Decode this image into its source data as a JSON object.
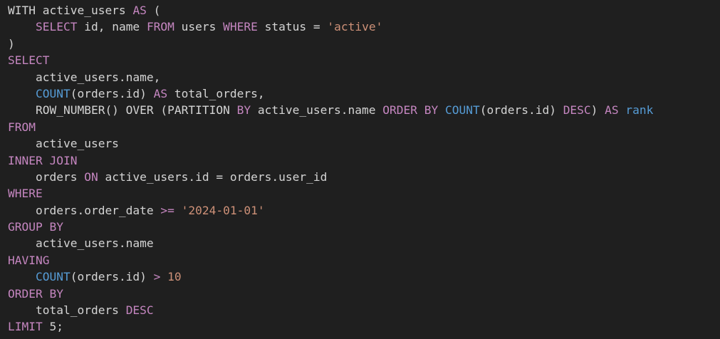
{
  "theme": {
    "background": "#1f1f1f",
    "default_text": "#d4d4d4",
    "keyword": "#c586c0",
    "function": "#569cd6",
    "string": "#ce9178",
    "number": "#ce9178"
  },
  "code_lines": [
    [
      {
        "t": "WITH active_users ",
        "k": "id"
      },
      {
        "t": "AS",
        "k": "kw"
      },
      {
        "t": " (",
        "k": "pun"
      }
    ],
    [
      {
        "t": "    ",
        "k": "ws"
      },
      {
        "t": "SELECT",
        "k": "kw"
      },
      {
        "t": " id, name ",
        "k": "id"
      },
      {
        "t": "FROM",
        "k": "kw"
      },
      {
        "t": " users ",
        "k": "id"
      },
      {
        "t": "WHERE",
        "k": "kw"
      },
      {
        "t": " status = ",
        "k": "id"
      },
      {
        "t": "'active'",
        "k": "str"
      }
    ],
    [
      {
        "t": ")",
        "k": "pun"
      }
    ],
    [
      {
        "t": "SELECT",
        "k": "kw"
      }
    ],
    [
      {
        "t": "    active_users.name,",
        "k": "id"
      }
    ],
    [
      {
        "t": "    ",
        "k": "ws"
      },
      {
        "t": "COUNT",
        "k": "fn"
      },
      {
        "t": "(orders.id) ",
        "k": "id"
      },
      {
        "t": "AS",
        "k": "kw"
      },
      {
        "t": " total_orders,",
        "k": "id"
      }
    ],
    [
      {
        "t": "    ROW_NUMBER() OVER (PARTITION ",
        "k": "id"
      },
      {
        "t": "BY",
        "k": "kw"
      },
      {
        "t": " active_users.name ",
        "k": "id"
      },
      {
        "t": "ORDER BY",
        "k": "kw"
      },
      {
        "t": " ",
        "k": "ws"
      },
      {
        "t": "COUNT",
        "k": "fn"
      },
      {
        "t": "(orders.id) ",
        "k": "id"
      },
      {
        "t": "DESC",
        "k": "kw"
      },
      {
        "t": ") ",
        "k": "pun"
      },
      {
        "t": "AS",
        "k": "kw"
      },
      {
        "t": " ",
        "k": "ws"
      },
      {
        "t": "rank",
        "k": "fn"
      }
    ],
    [
      {
        "t": "FROM",
        "k": "kw"
      }
    ],
    [
      {
        "t": "    active_users",
        "k": "id"
      }
    ],
    [
      {
        "t": "INNER JOIN",
        "k": "kw"
      }
    ],
    [
      {
        "t": "    orders ",
        "k": "id"
      },
      {
        "t": "ON",
        "k": "kw"
      },
      {
        "t": " active_users.id = orders.user_id",
        "k": "id"
      }
    ],
    [
      {
        "t": "WHERE",
        "k": "kw"
      }
    ],
    [
      {
        "t": "    orders.order_date ",
        "k": "id"
      },
      {
        "t": ">=",
        "k": "kw"
      },
      {
        "t": " ",
        "k": "ws"
      },
      {
        "t": "'2024-01-01'",
        "k": "str"
      }
    ],
    [
      {
        "t": "GROUP BY",
        "k": "kw"
      }
    ],
    [
      {
        "t": "    active_users.name",
        "k": "id"
      }
    ],
    [
      {
        "t": "HAVING",
        "k": "kw"
      }
    ],
    [
      {
        "t": "    ",
        "k": "ws"
      },
      {
        "t": "COUNT",
        "k": "fn"
      },
      {
        "t": "(orders.id) ",
        "k": "id"
      },
      {
        "t": ">",
        "k": "kw"
      },
      {
        "t": " ",
        "k": "ws"
      },
      {
        "t": "10",
        "k": "num"
      }
    ],
    [
      {
        "t": "ORDER BY",
        "k": "kw"
      }
    ],
    [
      {
        "t": "    total_orders ",
        "k": "id"
      },
      {
        "t": "DESC",
        "k": "kw"
      }
    ],
    [
      {
        "t": "LIMIT",
        "k": "kw"
      },
      {
        "t": " 5;",
        "k": "id"
      }
    ]
  ]
}
